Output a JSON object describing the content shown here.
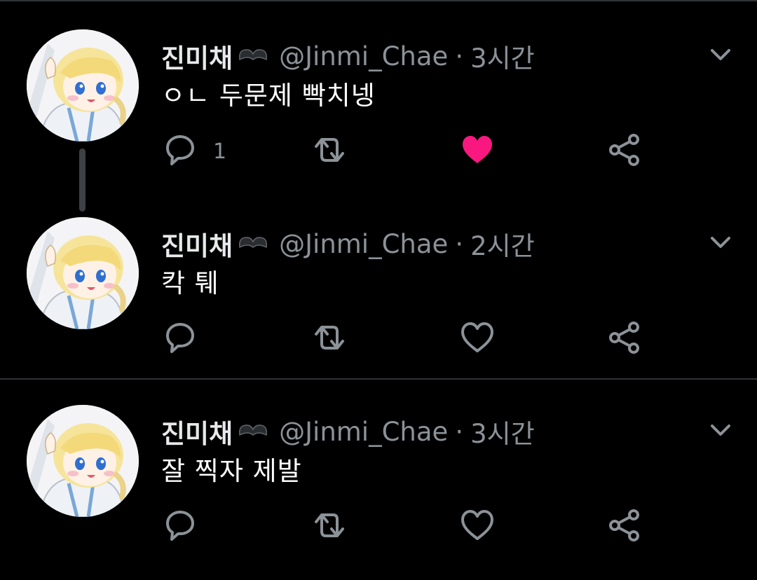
{
  "colors": {
    "background": "#000000",
    "name": "#e7e9ea",
    "meta": "#8b9298",
    "text": "#ffffff",
    "icon": "#8b9298",
    "liked": "#f91880",
    "divider": "#2f3336"
  },
  "tweets": [
    {
      "name": "진미채",
      "handle": "@Jinmi_Chae",
      "time": "3시간",
      "text": "ㅇㄴ 두문제 빡치넹",
      "reply_count": "1",
      "liked": true,
      "icons": [
        "reply-icon",
        "retweet-icon",
        "like-icon-filled",
        "share-icon",
        "chevron-down-icon"
      ]
    },
    {
      "name": "진미채",
      "handle": "@Jinmi_Chae",
      "time": "2시간",
      "text": "칵 퉤",
      "reply_count": "",
      "liked": false,
      "icons": [
        "reply-icon",
        "retweet-icon",
        "like-icon",
        "share-icon",
        "chevron-down-icon"
      ]
    },
    {
      "name": "진미채",
      "handle": "@Jinmi_Chae",
      "time": "3시간",
      "text": "잘 찍자 제발",
      "reply_count": "",
      "liked": false,
      "icons": [
        "reply-icon",
        "retweet-icon",
        "like-icon",
        "share-icon",
        "chevron-down-icon"
      ]
    }
  ]
}
